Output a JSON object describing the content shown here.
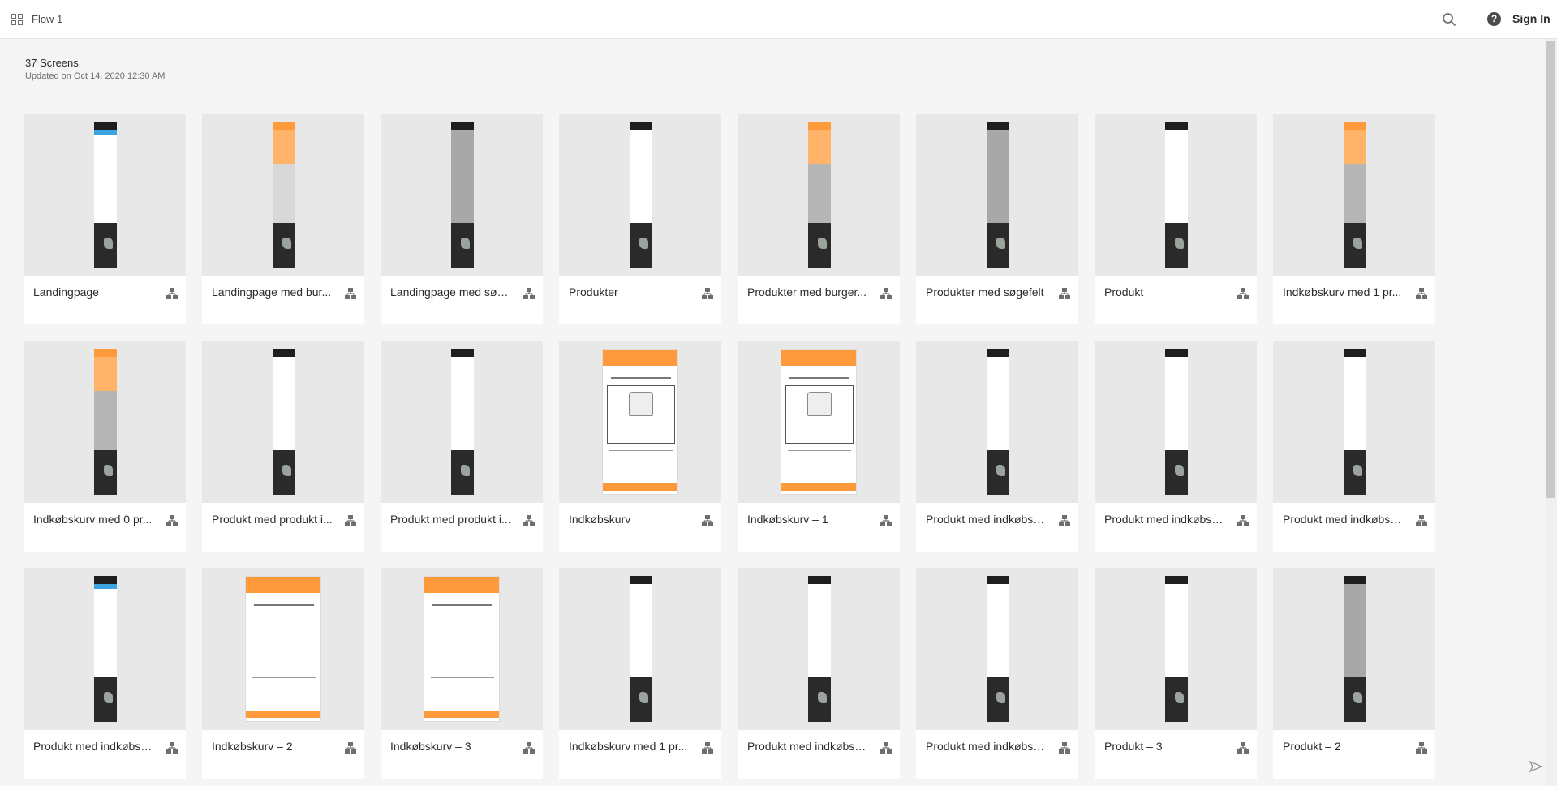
{
  "header": {
    "flow_title": "Flow 1",
    "sign_in": "Sign In",
    "icons": {
      "apps": "grid-icon",
      "search": "search-icon",
      "help": "help-icon"
    }
  },
  "summary": {
    "screen_count": "37 Screens",
    "updated": "Updated on Oct 14, 2020 12:30 AM"
  },
  "colors": {
    "accent_orange": "#ff9a3c",
    "dark_footer": "#2a2a2a",
    "thumb_bg": "#e8e8e8"
  },
  "cards": [
    {
      "label": "Landingpage",
      "thumb": "tall-blue"
    },
    {
      "label": "Landingpage med bur...",
      "thumb": "tall-orange"
    },
    {
      "label": "Landingpage med søg...",
      "thumb": "tall-gray"
    },
    {
      "label": "Produkter",
      "thumb": "tall-white"
    },
    {
      "label": "Produkter med burger...",
      "thumb": "tall-orange-gray"
    },
    {
      "label": "Produkter med søgefelt",
      "thumb": "tall-gray"
    },
    {
      "label": "Produkt",
      "thumb": "tall-white"
    },
    {
      "label": "Indkøbskurv med 1 pr...",
      "thumb": "tall-orange-gray"
    },
    {
      "label": "Indkøbskurv med 0 pr...",
      "thumb": "tall-orange-gray"
    },
    {
      "label": "Produkt med produkt i...",
      "thumb": "tall-white"
    },
    {
      "label": "Produkt med produkt i...",
      "thumb": "tall-white"
    },
    {
      "label": "Indkøbskurv",
      "thumb": "cart-full"
    },
    {
      "label": "Indkøbskurv – 1",
      "thumb": "cart-full"
    },
    {
      "label": "Produkt med indkøbsk...",
      "thumb": "tall-white"
    },
    {
      "label": "Produkt med indkøbsk...",
      "thumb": "tall-white"
    },
    {
      "label": "Produkt med indkøbsk...",
      "thumb": "tall-white"
    },
    {
      "label": "Produkt med indkøbsk...",
      "thumb": "tall-blue"
    },
    {
      "label": "Indkøbskurv – 2",
      "thumb": "cart-empty"
    },
    {
      "label": "Indkøbskurv – 3",
      "thumb": "cart-empty"
    },
    {
      "label": "Indkøbskurv med 1 pr...",
      "thumb": "tall-white"
    },
    {
      "label": "Produkt med indkøbsk...",
      "thumb": "tall-white"
    },
    {
      "label": "Produkt med indkøbsk...",
      "thumb": "tall-white"
    },
    {
      "label": "Produkt – 3",
      "thumb": "tall-white"
    },
    {
      "label": "Produkt – 2",
      "thumb": "tall-gray"
    }
  ],
  "card_icon": "hierarchy-icon"
}
